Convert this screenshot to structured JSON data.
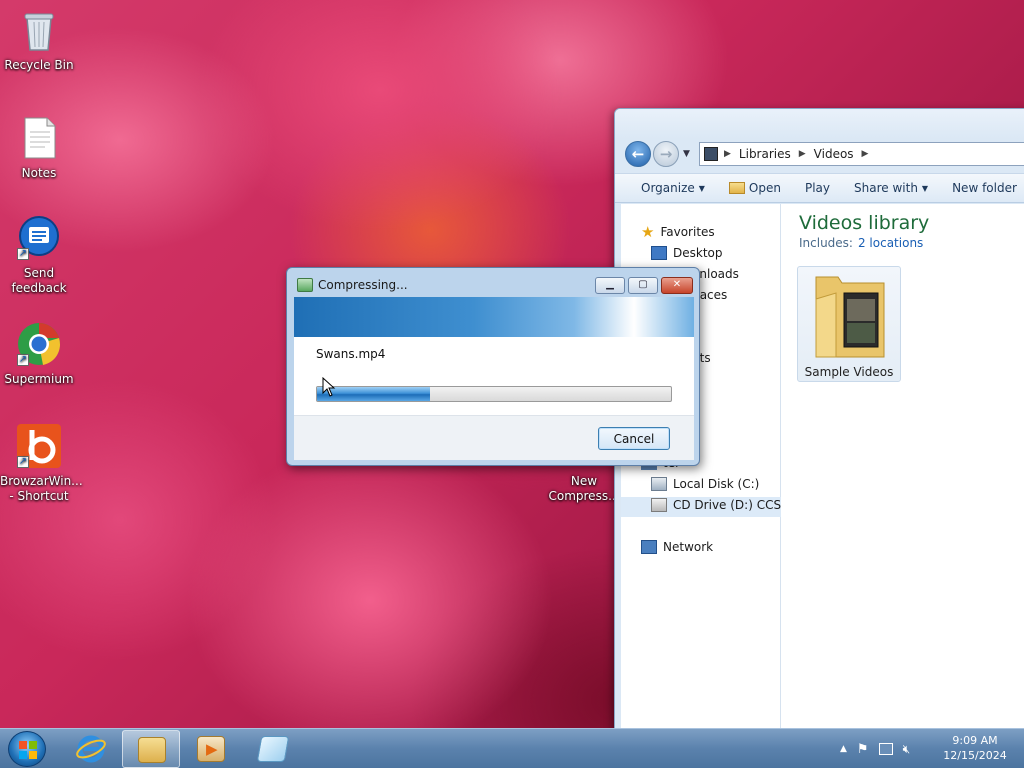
{
  "desktop": {
    "icons": [
      {
        "label": "Recycle Bin",
        "icon": "recycle-bin-icon"
      },
      {
        "label": "Notes",
        "icon": "text-document-icon"
      },
      {
        "label": "Send feedback",
        "icon": "feedback-icon"
      },
      {
        "label": "Supermium",
        "icon": "supermium-browser-icon"
      },
      {
        "label": "BrowzarWin... - Shortcut",
        "icon": "browzar-icon"
      },
      {
        "label": "New Compress...",
        "icon": "compressed-folder-icon"
      }
    ]
  },
  "explorer": {
    "breadcrumb": [
      "Libraries",
      "Videos"
    ],
    "toolbar": {
      "organize": "Organize",
      "open": "Open",
      "play": "Play",
      "share_with": "Share with",
      "new_folder": "New folder"
    },
    "nav": {
      "favorites": "Favorites",
      "desktop": "Desktop",
      "downloads": "Downloads",
      "recent_places": "nt Places",
      "libraries_partial": "s",
      "documents_partial": "ments",
      "music_partial": "c",
      "pictures_partial": "res",
      "videos_partial": "s",
      "computer_partial": "ter",
      "local_disk": "Local Disk (C:)",
      "cd_drive": "CD Drive (D:) CCSA_",
      "network": "Network"
    },
    "library": {
      "title": "Videos library",
      "includes_label": "Includes:",
      "locations_link": "2 locations",
      "folder": "Sample Videos"
    }
  },
  "dialog": {
    "title": "Compressing...",
    "file": "Swans.mp4",
    "progress": 0.32,
    "cancel_label": "Cancel"
  },
  "taskbar": {
    "time": "9:09 AM",
    "date": "12/15/2024"
  }
}
